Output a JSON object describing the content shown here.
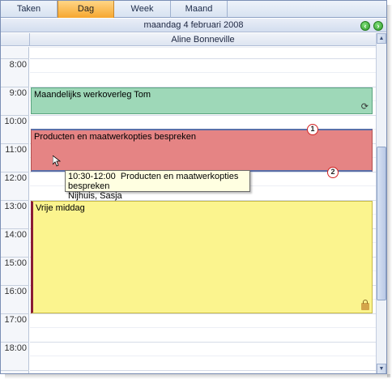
{
  "tabs": [
    {
      "label": "Taken",
      "active": false
    },
    {
      "label": "Dag",
      "active": true
    },
    {
      "label": "Week",
      "active": false
    },
    {
      "label": "Maand",
      "active": false
    }
  ],
  "date_header": "maandag 4 februari 2008",
  "resource": "Aline Bonneville",
  "hours": [
    "8:00",
    "9:00",
    "10:00",
    "11:00",
    "12:00",
    "13:00",
    "14:00",
    "15:00",
    "16:00",
    "17:00",
    "18:00"
  ],
  "appointments": [
    {
      "title": "Maandelijks werkoverleg Tom",
      "color": "#9ed8b8",
      "icon": "recurrence-icon"
    },
    {
      "title": "Producten en maatwerkopties bespreken",
      "color": "#e58484"
    },
    {
      "title": "Vrije middag",
      "color": "#fbf48e",
      "icon": "lock-icon"
    }
  ],
  "callouts": [
    "1",
    "2"
  ],
  "tooltip": {
    "time": "10:30-12:00",
    "subject": "Producten en maatwerkopties bespreken",
    "person": "Nijhuis, Sasja"
  },
  "colors": {
    "accent_tab": "#f6a730",
    "nav_green": "#2f9a2a",
    "callout_red": "#d32222"
  }
}
